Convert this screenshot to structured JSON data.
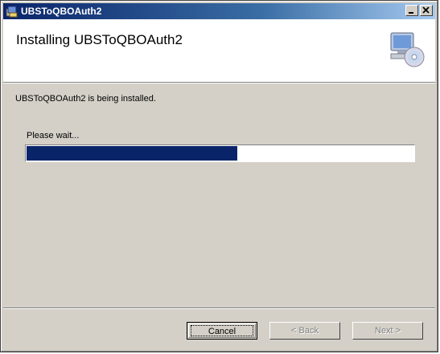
{
  "window": {
    "title": "UBSToQBOAuth2",
    "icons": {
      "app": "installer-icon",
      "minimize": "minimize-icon",
      "close": "close-icon"
    }
  },
  "banner": {
    "title": "Installing UBSToQBOAuth2",
    "icon": "computer-cd-icon"
  },
  "main": {
    "status_text": "UBSToQBOAuth2 is being installed.",
    "wait_label": "Please wait...",
    "progress_fraction": 0.545
  },
  "buttons": {
    "cancel": "Cancel",
    "back": "< Back",
    "next": "Next >"
  },
  "colors": {
    "progress_fill": "#0a246a",
    "titlebar_start": "#0a246a",
    "face": "#d4d0c8"
  }
}
